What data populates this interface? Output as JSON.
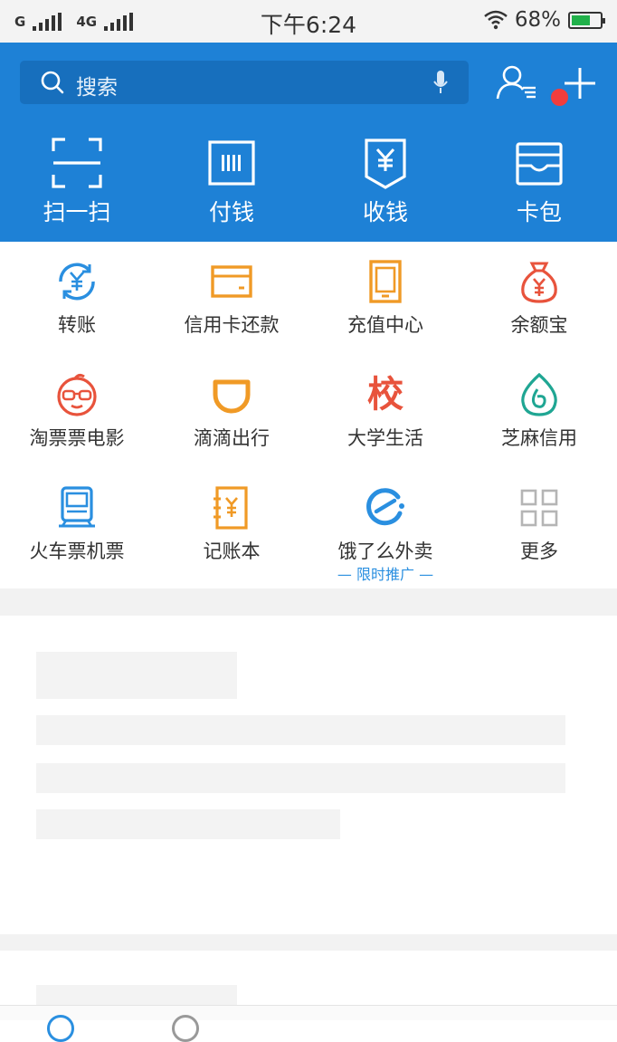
{
  "status_bar": {
    "network1": "G",
    "network2": "4G",
    "time": "下午6:24",
    "battery": "68%",
    "battery_level": 0.68
  },
  "header": {
    "search_placeholder": "搜索",
    "quick_actions": [
      {
        "label": "扫一扫",
        "icon": "scan-icon"
      },
      {
        "label": "付钱",
        "icon": "pay-barcode-icon"
      },
      {
        "label": "收钱",
        "icon": "receive-money-icon"
      },
      {
        "label": "卡包",
        "icon": "card-wallet-icon"
      }
    ]
  },
  "grid": {
    "items": [
      {
        "label": "转账",
        "icon": "transfer-icon"
      },
      {
        "label": "信用卡还款",
        "icon": "credit-card-icon"
      },
      {
        "label": "充值中心",
        "icon": "phone-recharge-icon"
      },
      {
        "label": "余额宝",
        "icon": "money-bag-icon"
      },
      {
        "label": "淘票票电影",
        "icon": "movie-mascot-icon"
      },
      {
        "label": "滴滴出行",
        "icon": "didi-icon"
      },
      {
        "label": "大学生活",
        "icon": "campus-icon",
        "glyph": "校"
      },
      {
        "label": "芝麻信用",
        "icon": "sesame-credit-icon"
      },
      {
        "label": "火车票机票",
        "icon": "train-icon"
      },
      {
        "label": "记账本",
        "icon": "ledger-icon"
      },
      {
        "label": "饿了么外卖",
        "icon": "eleme-icon",
        "sub": "— 限时推广 —"
      },
      {
        "label": "更多",
        "icon": "more-grid-icon"
      }
    ]
  },
  "colors": {
    "header_blue": "#1e81d6",
    "search_bg": "#176fbd",
    "orange": "#f09a26",
    "red": "#e8533c",
    "teal": "#1fa693",
    "blue": "#2a8fe0"
  }
}
